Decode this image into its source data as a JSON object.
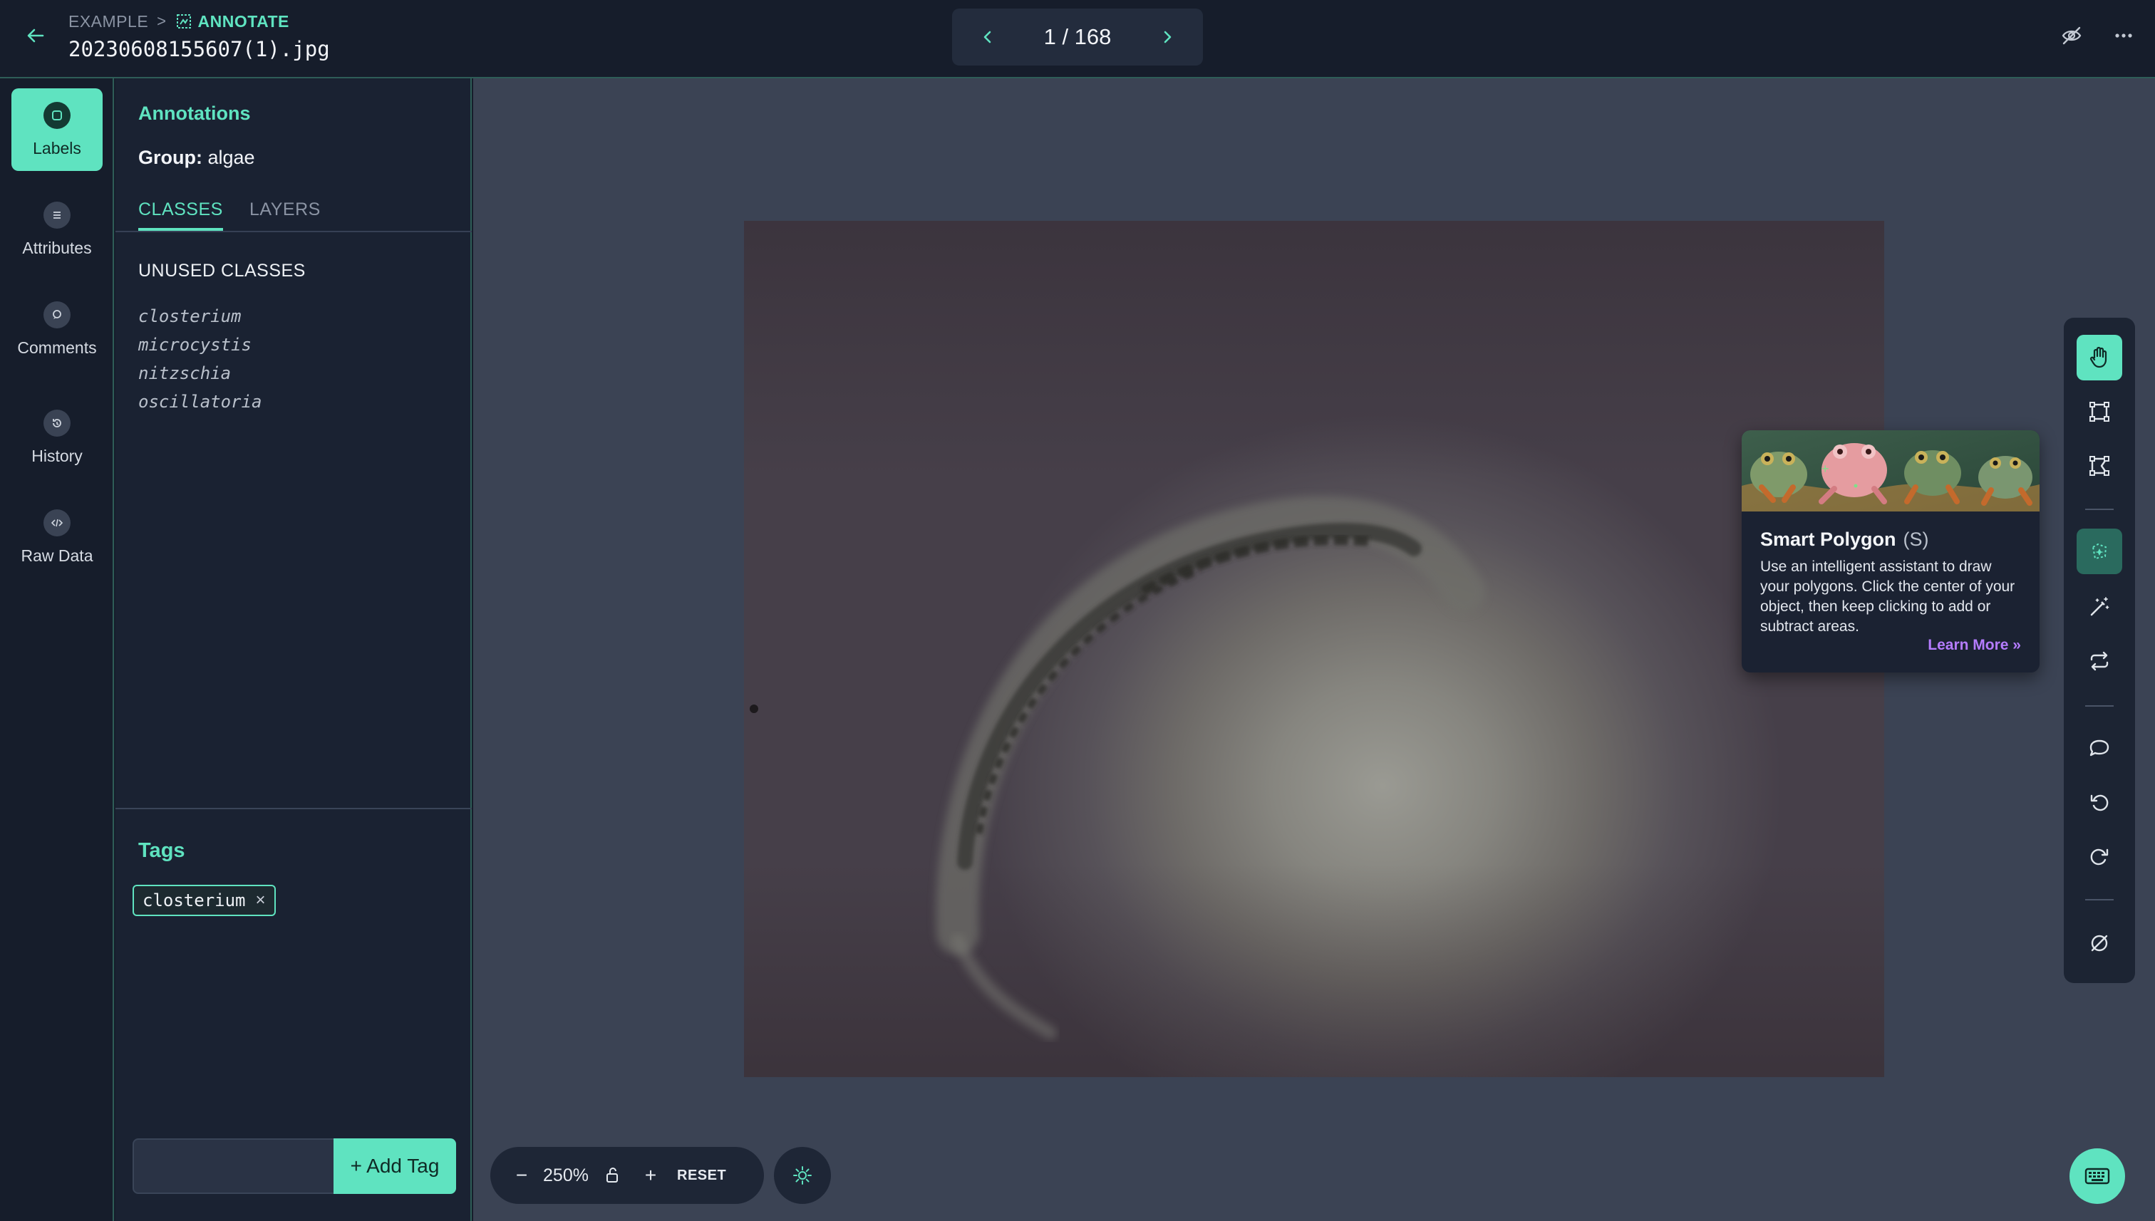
{
  "breadcrumb": {
    "root": "EXAMPLE",
    "separator": ">",
    "current": "ANNOTATE"
  },
  "file": {
    "name": "20230608155607(1).jpg"
  },
  "pager": {
    "text": "1 / 168"
  },
  "rail": {
    "items": [
      {
        "label": "Labels",
        "icon": "tag-icon",
        "active": true
      },
      {
        "label": "Attributes",
        "icon": "list-icon",
        "active": false
      },
      {
        "label": "Comments",
        "icon": "comment-icon",
        "active": false
      },
      {
        "label": "History",
        "icon": "history-icon",
        "active": false
      },
      {
        "label": "Raw Data",
        "icon": "code-icon",
        "active": false
      }
    ]
  },
  "panel": {
    "title": "Annotations",
    "group_key": "Group:",
    "group_value": "algae",
    "tabs": [
      {
        "label": "CLASSES",
        "active": true
      },
      {
        "label": "LAYERS",
        "active": false
      }
    ],
    "unused_title": "UNUSED CLASSES",
    "unused_classes": [
      "closterium",
      "microcystis",
      "nitzschia",
      "oscillatoria"
    ]
  },
  "tags": {
    "title": "Tags",
    "items": [
      {
        "label": "closterium",
        "remove": "×"
      }
    ],
    "input_value": "",
    "add_label": "+ Add Tag"
  },
  "zoom": {
    "out": "−",
    "level": "250%",
    "in": "+",
    "reset": "RESET"
  },
  "toolbar": {
    "tools": [
      "hand-icon",
      "bounding-box-icon",
      "polygon-icon",
      "smart-polygon-icon",
      "magic-wand-icon",
      "repeat-icon",
      "comment-icon",
      "undo-icon",
      "redo-icon",
      "null-icon"
    ],
    "active_tool": "hand-icon"
  },
  "tooltip": {
    "title": "Smart Polygon",
    "shortcut": "(S)",
    "body": "Use an intelligent assistant to draw your polygons. Click the center of your object, then keep clicking to add or subtract areas.",
    "link": "Learn More »"
  },
  "colors": {
    "accent": "#5fe3c0",
    "panel": "#1a2232",
    "canvas": "#3b4354",
    "link": "#b57cff"
  }
}
